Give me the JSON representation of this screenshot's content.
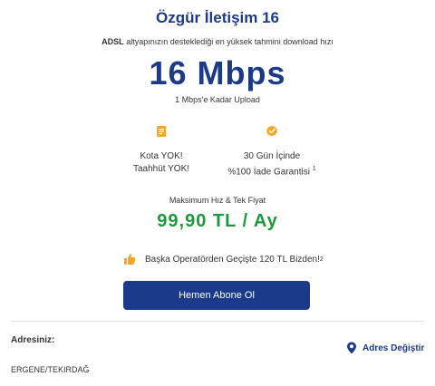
{
  "plan": {
    "title": "Özgür İletişim 16",
    "subline_bold": "ADSL",
    "subline_text": "altyapınızın desteklediği en yüksek tahmini download hızı",
    "speed": "16 Mbps",
    "upload": "1 Mbps'e Kadar Upload"
  },
  "features": [
    {
      "icon": "document-icon",
      "line1": "Kota YOK!",
      "line2": "Taahhüt YOK!",
      "sup": ""
    },
    {
      "icon": "check-badge-icon",
      "line1": "30 Gün İçinde",
      "line2": "%100 İade Garantisi",
      "sup": "1"
    }
  ],
  "pricing": {
    "label": "Maksimum Hız & Tek Fiyat",
    "price": "99,90 TL / Ay"
  },
  "promo": {
    "icon": "thumbs-up-icon",
    "text": "Başka Operatörden Geçişte 120 TL Bizden!",
    "sup": "2"
  },
  "cta": {
    "label": "Hemen Abone Ol"
  },
  "address": {
    "label": "Adresiniz:",
    "value": "ERGENE/TEKIRDAĞ",
    "change_label": "Adres Değiştir",
    "change_icon": "location-pin-icon"
  },
  "colors": {
    "brand_blue": "#1b3a8a",
    "price_green": "#1a9a3a",
    "icon_orange": "#f5a623"
  }
}
